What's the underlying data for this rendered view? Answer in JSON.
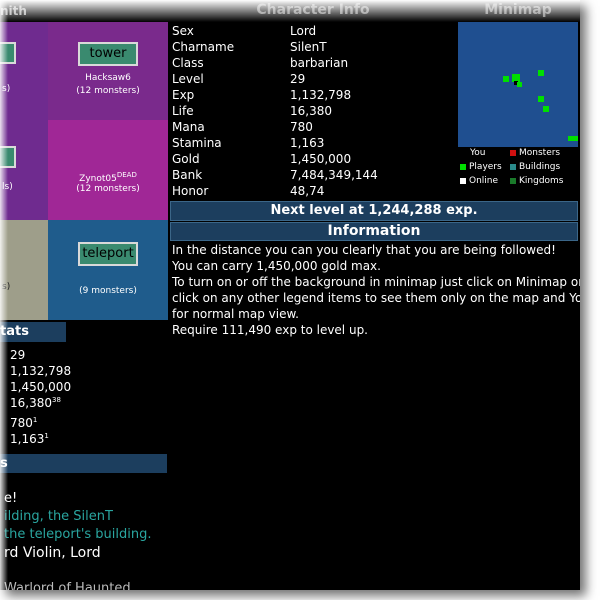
{
  "map": {
    "top_left_header": "nith",
    "tiles": {
      "tower": {
        "button": "tower",
        "player": "Hacksaw6",
        "monsters": "(12 monsters)",
        "side_text": "s)"
      },
      "dead": {
        "player": "Zynot05",
        "dead_tag": "DEAD",
        "monsters": "(12 monsters)",
        "side_text": "ls)"
      },
      "teleport": {
        "button": "teleport",
        "monsters": "(9 monsters)",
        "side_text": "s)"
      }
    }
  },
  "stats": {
    "header": "tats",
    "values": [
      {
        "value": "29",
        "sup": ""
      },
      {
        "value": "1,132,798",
        "sup": ""
      },
      {
        "value": "1,450,000",
        "sup": ""
      },
      {
        "value": "16,380",
        "sup": "38"
      },
      {
        "value": "780",
        "sup": "1"
      },
      {
        "value": "1,163",
        "sup": "1"
      }
    ]
  },
  "messages": {
    "header": "s",
    "lines": [
      {
        "text": "e!",
        "color": "#ffffff"
      },
      {
        "text": "ilding, the SilenT",
        "color": "#2aa6a0"
      },
      {
        "text": "the teleport's building.",
        "color": "#2aa6a0"
      },
      {
        "text": "rd Violin, Lord",
        "color": "#ffffff"
      },
      {
        "text": "Warlord of Haunted",
        "color": "#bbbbbb"
      }
    ]
  },
  "character": {
    "header": "Character Info",
    "rows": [
      {
        "label": "Sex",
        "value": "Lord"
      },
      {
        "label": "Charname",
        "value": "SilenT"
      },
      {
        "label": "Class",
        "value": "barbarian"
      },
      {
        "label": "Level",
        "value": "29"
      },
      {
        "label": "Exp",
        "value": "1,132,798"
      },
      {
        "label": "Life",
        "value": "16,380"
      },
      {
        "label": "Mana",
        "value": "780"
      },
      {
        "label": "Stamina",
        "value": "1,163"
      },
      {
        "label": "Gold",
        "value": "1,450,000"
      },
      {
        "label": "Bank",
        "value": "7,484,349,144"
      },
      {
        "label": "Honor",
        "value": "48,74"
      }
    ]
  },
  "minimap": {
    "header": "Minimap",
    "legend": [
      {
        "label": "You",
        "color": ""
      },
      {
        "label": "Monsters",
        "color": "#d01010"
      },
      {
        "label": "Players",
        "color": "#00e000"
      },
      {
        "label": "Buildings",
        "color": "#2a8a8a"
      },
      {
        "label": "Online",
        "color": "#ffffff"
      },
      {
        "label": "Kingdoms",
        "color": "#1a7a2a"
      }
    ]
  },
  "next_level": "Next level at 1,244,288 exp.",
  "information": {
    "header": "Information",
    "lines": [
      "In the distance you can you clearly that you are being followed!",
      "You can carry 1,450,000 gold max.",
      "To turn on or off the background in minimap just click on Minimap or",
      "click on any other legend items to see them only on the map and You",
      "for normal map view.",
      "Require 111,490 exp to level up."
    ]
  }
}
